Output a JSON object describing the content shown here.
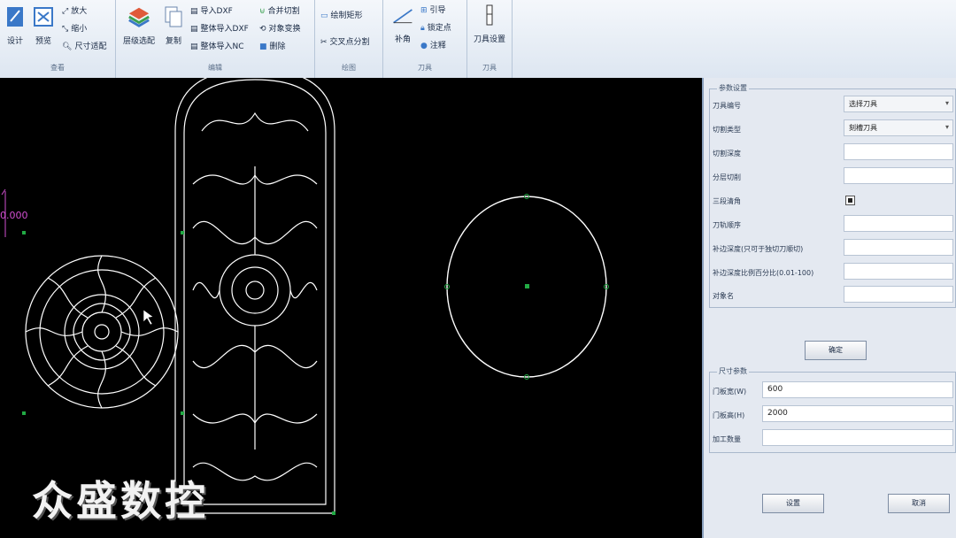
{
  "ribbon": {
    "group1": {
      "label": "查看",
      "design": "设计",
      "preview": "预览",
      "zoom_in": "放大",
      "zoom_out": "缩小",
      "fit": "尺寸适配"
    },
    "group2": {
      "label": "编辑",
      "layer": "层级选配",
      "copy": "复制",
      "import_dxf": "导入DXF",
      "whole_import_dxf": "整体导入DXF",
      "whole_import_nc": "整体导入NC",
      "merge": "合并切割",
      "reshape": "对象变换",
      "delete": "删除"
    },
    "group3": {
      "label": "绘图",
      "draw_rect": "绘制矩形",
      "cross_split": "交叉点分割"
    },
    "group4": {
      "label": "刀具",
      "chamfer": "补角",
      "guide": "引导",
      "lock": "锁定点",
      "note": "注释"
    },
    "group5": {
      "label": "刀具",
      "tool_settings": "刀具设置"
    }
  },
  "canvas": {
    "axis_label": "0.000",
    "watermark": "众盛数控"
  },
  "panel": {
    "params_title": "参数设置",
    "rows": [
      {
        "label": "刀具编号",
        "value": "选择刀具",
        "kind": "combo"
      },
      {
        "label": "切割类型",
        "value": "刻槽刀具",
        "kind": "combo"
      },
      {
        "label": "切割深度",
        "value": "",
        "kind": "field"
      },
      {
        "label": "分层切削",
        "value": "",
        "kind": "field"
      },
      {
        "label": "三段清角",
        "value": "",
        "kind": "check"
      },
      {
        "label": "刀轨顺序",
        "value": "",
        "kind": "field"
      },
      {
        "label": "补边深度(只可于独切刀顺切)",
        "value": "",
        "kind": "field"
      },
      {
        "label": "补边深度比例百分比(0.01-100)",
        "value": "",
        "kind": "field"
      },
      {
        "label": "对象名",
        "value": "",
        "kind": "field"
      }
    ],
    "confirm": "确定",
    "size_title": "尺寸参数",
    "size_rows": [
      {
        "label": "门板宽(W)",
        "value": "600"
      },
      {
        "label": "门板高(H)",
        "value": "2000"
      },
      {
        "label": "加工数量",
        "value": ""
      }
    ],
    "set_button": "设置",
    "cancel_button": "取消"
  },
  "colors": {
    "canvas_bg": "#000000",
    "drawing": "#ffffff",
    "node": "#22aa44",
    "axis": "#d24fd2"
  }
}
